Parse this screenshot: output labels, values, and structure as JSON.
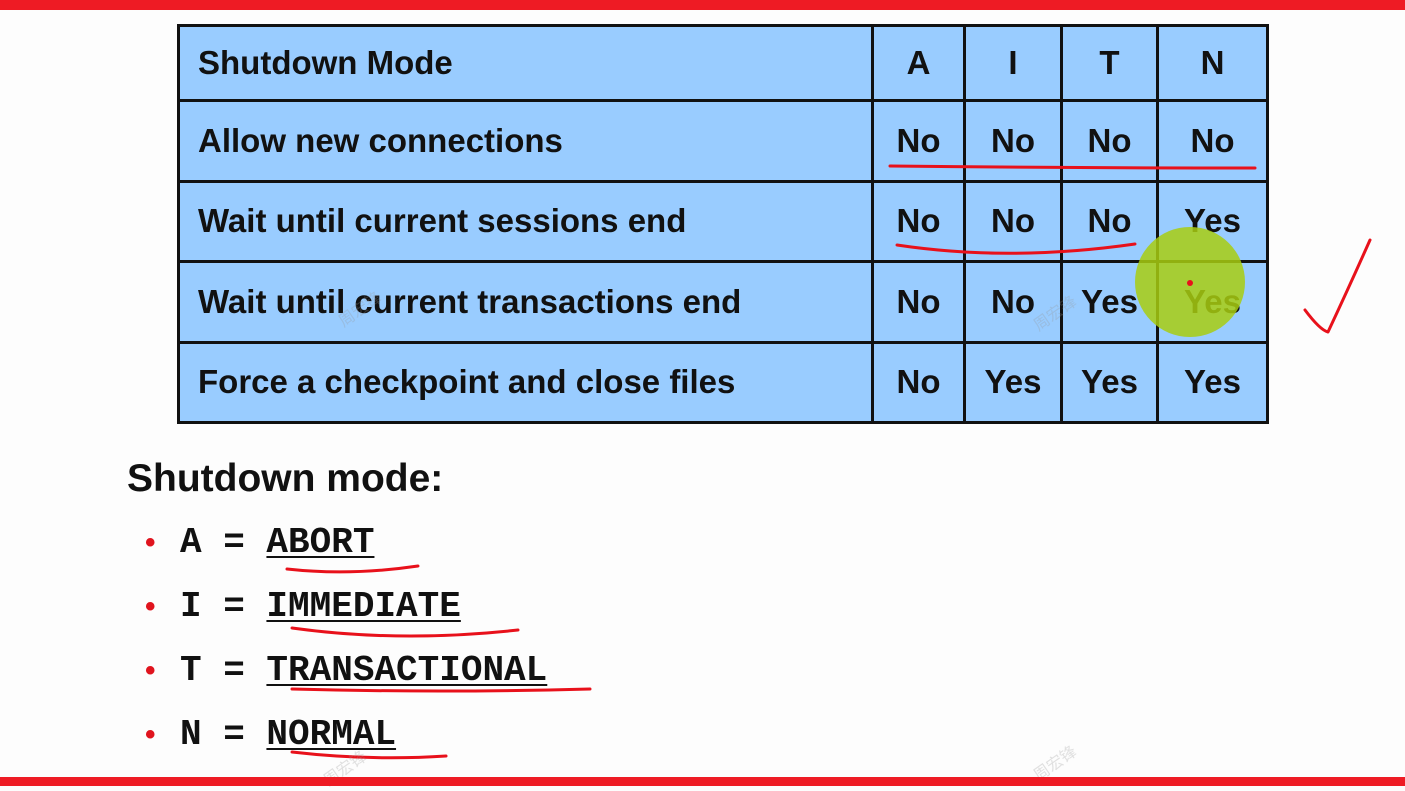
{
  "table": {
    "header": {
      "label": "Shutdown Mode",
      "columns": [
        "A",
        "I",
        "T",
        "N"
      ]
    },
    "rows": [
      {
        "label": "Allow new connections",
        "values": [
          "No",
          "No",
          "No",
          "No"
        ]
      },
      {
        "label": "Wait until current sessions end",
        "values": [
          "No",
          "No",
          "No",
          "Yes"
        ]
      },
      {
        "label": "Wait until current transactions end",
        "values": [
          "No",
          "No",
          "Yes",
          "Yes"
        ]
      },
      {
        "label": "Force a checkpoint and close files",
        "values": [
          "No",
          "Yes",
          "Yes",
          "Yes"
        ]
      }
    ]
  },
  "legend": {
    "title": "Shutdown mode:",
    "items": [
      {
        "key": "A",
        "eq": " = ",
        "value": "ABORT"
      },
      {
        "key": "I",
        "eq": " = ",
        "value": "IMMEDIATE"
      },
      {
        "key": "T",
        "eq": " = ",
        "value": "TRANSACTIONAL"
      },
      {
        "key": "N",
        "eq": " = ",
        "value": "NORMAL"
      }
    ],
    "bullet": "•"
  },
  "colors": {
    "frame_red": "#ee1b24",
    "table_bg": "#99ccff",
    "annotation_red": "#e8111b",
    "highlight_green": "#a8cc10"
  },
  "annotations": {
    "checkmark": "✓",
    "watermark": "周宏锋"
  }
}
